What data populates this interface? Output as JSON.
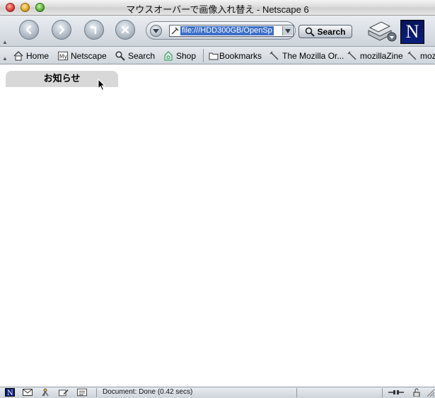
{
  "window": {
    "title": "マウスオーバーで画像入れ替え - Netscape 6"
  },
  "navbar": {
    "back_icon": "back-arrow-icon",
    "forward_icon": "forward-arrow-icon",
    "reload_icon": "reload-icon",
    "stop_icon": "stop-icon",
    "url_value": "file:///HDD300GB/OpenSp",
    "search_label": "Search"
  },
  "personal_toolbar": {
    "items": [
      {
        "label": "Home",
        "icon": "home-icon"
      },
      {
        "label": "Netscape",
        "icon": "my-netscape-icon"
      },
      {
        "label": "Search",
        "icon": "search-icon"
      },
      {
        "label": "Shop",
        "icon": "shop-icon"
      },
      {
        "label": "Bookmarks",
        "icon": "folder-icon"
      },
      {
        "label": "The Mozilla Or...",
        "icon": "bookmark-icon"
      },
      {
        "label": "mozillaZine",
        "icon": "bookmark-icon"
      },
      {
        "label": "moz",
        "icon": "bookmark-icon"
      }
    ]
  },
  "content": {
    "tab_label": "お知らせ"
  },
  "statusbar": {
    "status_text": "Document: Done (0.42 secs)"
  },
  "colors": {
    "url_selection": "#3d6fc9",
    "tab_background": "#d8d8d8",
    "logo_background": "#0a1f7a"
  }
}
